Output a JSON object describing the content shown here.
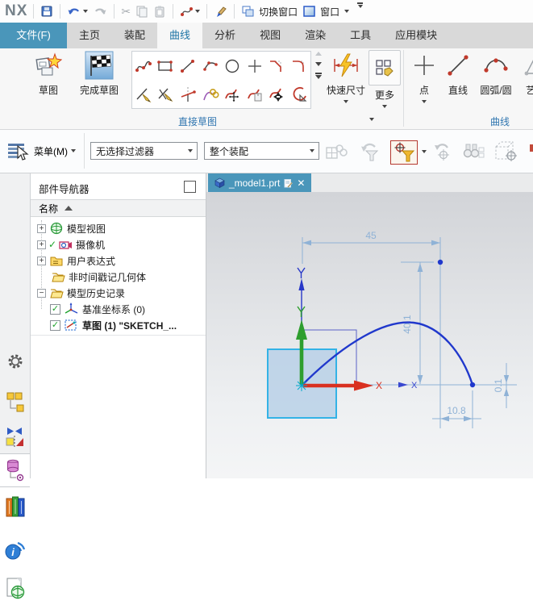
{
  "titlebar": {
    "logo": "NX",
    "switch_window_label": "切换窗口",
    "window_label": "窗口",
    "icons": [
      "save-icon",
      "undo-icon",
      "redo-icon",
      "cut-icon",
      "copy-icon",
      "paste-icon",
      "spline-icon",
      "format-painter-icon",
      "switch-window-icon",
      "window-icon"
    ]
  },
  "ribbon_tabs": {
    "file": "文件(F)",
    "items": [
      "主页",
      "装配",
      "曲线",
      "分析",
      "视图",
      "渲染",
      "工具",
      "应用模块"
    ],
    "active": "曲线"
  },
  "ribbon": {
    "sketch_label": "草图",
    "finish_sketch_label": "完成草图",
    "direct_sketch_group_label": "直接草图",
    "curve_group_label": "曲线",
    "quick_dim_label": "快速尺寸",
    "more_label": "更多",
    "point_label": "点",
    "line_label": "直线",
    "arc_circle_label": "圆弧/圆",
    "art_spline_label": "艺术",
    "gallery_icons": [
      "studio-spline",
      "rectangle",
      "line",
      "arc",
      "circle",
      "point",
      "chamfer",
      "fillet",
      "trim-curve",
      "extend-curve",
      "quick-trim",
      "project-curve",
      "move-curve",
      "offset-curve",
      "pattern-curve",
      "polygon"
    ]
  },
  "toolbar": {
    "menu_label": "菜单(M)",
    "selection_filter_value": "无选择过滤器",
    "selection_scope_value": "整个装配",
    "icons": [
      "interpart-link-icon",
      "reset-filter-icon",
      "snap-point-filter-icon",
      "undo-selection-icon",
      "find-component-icon",
      "show-in-window-icon"
    ]
  },
  "sidebar_icons": [
    "roller-gear",
    "assembly-navigator",
    "constraint-navigator",
    "part-navigator",
    "reuse-library",
    "hd3d-tools",
    "web-browser"
  ],
  "navigator": {
    "title": "部件导航器",
    "name_column": "名称",
    "rows": [
      {
        "label": "模型视图",
        "expand": "+"
      },
      {
        "label": "摄像机",
        "expand": "+",
        "checked": true
      },
      {
        "label": "用户表达式",
        "expand": "+"
      },
      {
        "label": "非时间戳记几何体"
      },
      {
        "label": "模型历史记录",
        "expand": "-"
      },
      {
        "label": "基准坐标系 (0)",
        "checkbox": true
      },
      {
        "label": "草图 (1) \"SKETCH_...",
        "checkbox": true,
        "bold": true
      }
    ]
  },
  "viewport": {
    "doc_tab": "_model1.prt",
    "sketch": {
      "dim_width": "45",
      "dim_height": "40.1",
      "dim_offset": "10.8",
      "dim_gap": "0.1",
      "axis_x_label": "X",
      "axis_x2_label": "X"
    }
  },
  "colors": {
    "accent_teal": "#4a96ba",
    "active_tab_text": "#1f76a6",
    "curve_blue": "#2038cc",
    "dimension_blue": "#8aafd2",
    "axis_red": "#d93020",
    "axis_green": "#2e9e2e",
    "datum_blue": "#2838c8",
    "plane_fill": "#b7cfe6",
    "plane_border": "#33b3e6"
  }
}
